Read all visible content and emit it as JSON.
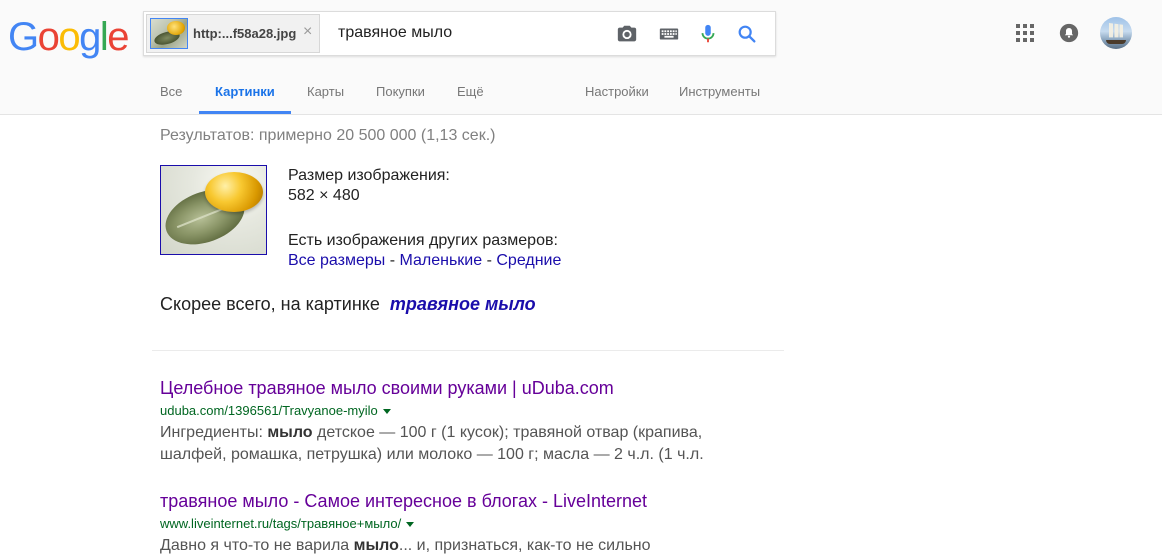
{
  "logo": {
    "letters": [
      "G",
      "o",
      "o",
      "g",
      "l",
      "e"
    ],
    "colors": [
      "#4285F4",
      "#EA4335",
      "#FBBC05",
      "#4285F4",
      "#34A853",
      "#EA4335"
    ]
  },
  "search": {
    "image_chip_label": "http:...f58a28.jpg",
    "chip_close": "×",
    "query": "травяное мыло",
    "accent_color": "#4285F4"
  },
  "header_icons": [
    "apps-icon",
    "notifications-icon",
    "account-avatar"
  ],
  "tabs": {
    "items": [
      {
        "label": "Все"
      },
      {
        "label": "Картинки",
        "active": true
      },
      {
        "label": "Карты"
      },
      {
        "label": "Покупки"
      },
      {
        "label": "Ещё"
      }
    ],
    "settings": "Настройки",
    "tools": "Инструменты"
  },
  "stats": "Результатов: примерно 20 500 000 (1,13 сек.)",
  "image_info": {
    "size_label": "Размер изображения:",
    "size_value": "582 × 480",
    "other_sizes_label": "Есть изображения других размеров:",
    "links": [
      "Все размеры",
      "Маленькие",
      "Средние"
    ],
    "separator": " - "
  },
  "best_guess": {
    "prefix": "Скорее всего, на картинке  ",
    "link": "травяное мыло"
  },
  "results": [
    {
      "title": "Целебное травяное мыло своими руками | uDuba.com",
      "url": "uduba.com/1396561/Travyanoe-myilo",
      "snippet_before": "Ингредиенты: ",
      "snippet_bold": "мыло",
      "snippet_after": " детское — 100 г (1 кусок); травяной отвар (крапива,",
      "snippet_line2": "шалфей, ромашка, петрушка) или молоко — 100 г; масла — 2 ч.л. (1 ч.л."
    },
    {
      "title": "травяное мыло - Самое интересное в блогах - LiveInternet",
      "url": "www.liveinternet.ru/tags/травяное+мыло/",
      "snippet_before": "Давно я что-то не варила ",
      "snippet_bold": "мыло",
      "snippet_after": "... и, признаться, как-то не сильно"
    }
  ]
}
